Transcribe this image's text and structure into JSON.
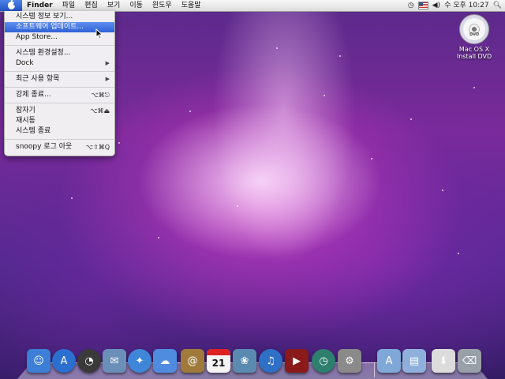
{
  "menubar": {
    "app_name": "Finder",
    "menus": [
      "파일",
      "편집",
      "보기",
      "이동",
      "윈도우",
      "도움말"
    ],
    "clock": "수 오후 10:27"
  },
  "apple_menu": {
    "items": [
      {
        "label": "시스템 정보 보기...",
        "shortcut": "",
        "submenu": false
      },
      {
        "label": "소프트웨어 업데이트...",
        "shortcut": "",
        "submenu": false,
        "highlighted": true
      },
      {
        "label": "App Store...",
        "shortcut": "",
        "submenu": false
      },
      {
        "label": "시스템 환경설정...",
        "shortcut": "",
        "submenu": false
      },
      {
        "label": "Dock",
        "shortcut": "",
        "submenu": true
      },
      {
        "label": "최근 사용 항목",
        "shortcut": "",
        "submenu": true
      },
      {
        "label": "강제 종료...",
        "shortcut": "⌥⌘⎋",
        "submenu": false
      },
      {
        "label": "잠자기",
        "shortcut": "⌥⌘⏏",
        "submenu": false
      },
      {
        "label": "재시동",
        "shortcut": "",
        "submenu": false
      },
      {
        "label": "시스템 종료",
        "shortcut": "",
        "submenu": false
      },
      {
        "label": "snoopy 로그 아웃",
        "shortcut": "⌥⇧⌘Q",
        "submenu": false
      }
    ]
  },
  "desktop": {
    "dvd_icon_label_line1": "Mac OS X",
    "dvd_icon_label_line2": "Install DVD",
    "dvd_disc_text": "DVD"
  },
  "dock": {
    "calendar_day": "21",
    "items": [
      {
        "name": "finder",
        "color": "#3d7fd6",
        "glyph": "☺"
      },
      {
        "name": "app-store",
        "color": "#2b6fd1",
        "glyph": "A"
      },
      {
        "name": "dashboard",
        "color": "#3a3a3a",
        "glyph": "◔"
      },
      {
        "name": "mail",
        "color": "#6a8fb8",
        "glyph": "✉"
      },
      {
        "name": "safari",
        "color": "#3f86d8",
        "glyph": "✦"
      },
      {
        "name": "ichat",
        "color": "#4f8ce0",
        "glyph": "☁"
      },
      {
        "name": "address-book",
        "color": "#a07a3a",
        "glyph": "@"
      },
      {
        "name": "ical",
        "color": "#f4f4f4",
        "glyph": ""
      },
      {
        "name": "iphoto",
        "color": "#5b8ab0",
        "glyph": "❀"
      },
      {
        "name": "itunes",
        "color": "#2f6fc6",
        "glyph": "♫"
      },
      {
        "name": "front-row",
        "color": "#8b1a1a",
        "glyph": "▶"
      },
      {
        "name": "time-machine",
        "color": "#2f7f6f",
        "glyph": "◷"
      },
      {
        "name": "system-preferences",
        "color": "#8a8a8a",
        "glyph": "⚙"
      },
      {
        "name": "applications-folder",
        "color": "#7fa8d8",
        "glyph": "A"
      },
      {
        "name": "documents-folder",
        "color": "#8fb0dc",
        "glyph": "▤"
      },
      {
        "name": "downloads-stack",
        "color": "#dcdcdc",
        "glyph": "⬇"
      },
      {
        "name": "trash",
        "color": "#9aa0a8",
        "glyph": "⌫"
      }
    ]
  }
}
